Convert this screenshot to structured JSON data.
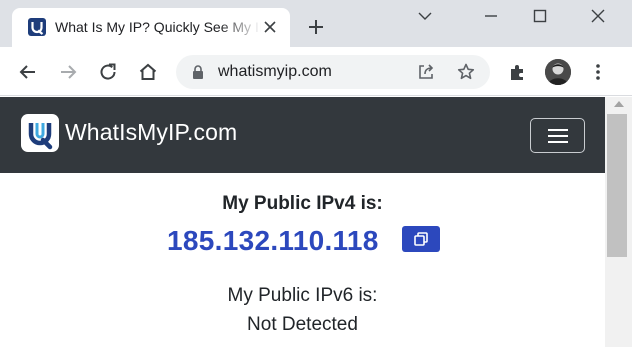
{
  "browser": {
    "tab": {
      "title": "What Is My IP? Quickly See My IP Address",
      "favicon": "whatismyip-favicon"
    },
    "new_tab_icon": "plus-icon",
    "window_controls": [
      "minimize-icon",
      "restore-icon",
      "close-icon"
    ],
    "toolbar": {
      "icons": [
        "back-arrow-icon",
        "forward-arrow-icon",
        "reload-icon",
        "home-icon",
        "extensions-icon",
        "kebab-menu-icon"
      ],
      "url": "whatismyip.com",
      "omnibox_icons": [
        "lock-icon",
        "share-icon",
        "star-icon"
      ]
    }
  },
  "site": {
    "brand_name": "WhatIsMyIP.com",
    "nav_icon": "hamburger-menu-icon",
    "colors": {
      "nav_background": "#33383d",
      "accent": "#2c48bd"
    }
  },
  "main": {
    "ipv4_label": "My Public IPv4 is:",
    "ipv4_value": "185.132.110.118",
    "copy_icon": "copy-icon",
    "ipv6_label": "My Public IPv6 is:",
    "ipv6_value": "Not Detected"
  }
}
